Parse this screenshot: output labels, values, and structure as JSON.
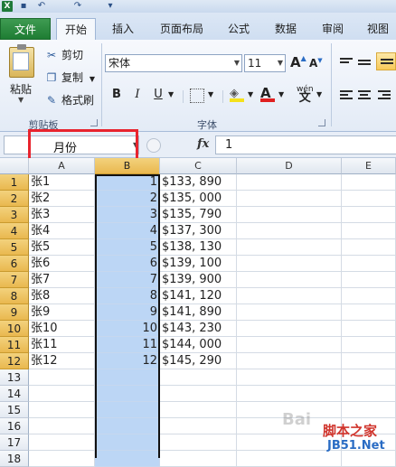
{
  "ribbon": {
    "tabs": [
      "文件",
      "开始",
      "插入",
      "页面布局",
      "公式",
      "数据",
      "审阅",
      "视图"
    ],
    "active_tab": "开始",
    "clipboard": {
      "paste": "粘贴",
      "cut": "剪切",
      "copy": "复制",
      "format_painter": "格式刷",
      "group_label": "剪贴板"
    },
    "font": {
      "name": "宋体",
      "size": "11",
      "bold": "B",
      "italic": "I",
      "underline": "U",
      "group_label": "字体",
      "grow": "A",
      "shrink": "A",
      "font_color": "A",
      "wen": "wén"
    }
  },
  "formula_bar": {
    "name_box": "月份",
    "fx": "fx",
    "formula": "1"
  },
  "grid": {
    "columns": [
      "A",
      "B",
      "C",
      "D",
      "E"
    ],
    "selected_column": "B",
    "rows": [
      {
        "n": "1",
        "a": "张1",
        "b": "1",
        "c": "$133, 890"
      },
      {
        "n": "2",
        "a": "张2",
        "b": "2",
        "c": "$135, 000"
      },
      {
        "n": "3",
        "a": "张3",
        "b": "3",
        "c": "$135, 790"
      },
      {
        "n": "4",
        "a": "张4",
        "b": "4",
        "c": "$137, 300"
      },
      {
        "n": "5",
        "a": "张5",
        "b": "5",
        "c": "$138, 130"
      },
      {
        "n": "6",
        "a": "张6",
        "b": "6",
        "c": "$139, 100"
      },
      {
        "n": "7",
        "a": "张7",
        "b": "7",
        "c": "$139, 900"
      },
      {
        "n": "8",
        "a": "张8",
        "b": "8",
        "c": "$141, 120"
      },
      {
        "n": "9",
        "a": "张9",
        "b": "9",
        "c": "$141, 890"
      },
      {
        "n": "10",
        "a": "张10",
        "b": "10",
        "c": "$143, 230"
      },
      {
        "n": "11",
        "a": "张11",
        "b": "11",
        "c": "$144, 000"
      },
      {
        "n": "12",
        "a": "张12",
        "b": "12",
        "c": "$145, 290"
      },
      {
        "n": "13",
        "a": "",
        "b": "",
        "c": ""
      },
      {
        "n": "14",
        "a": "",
        "b": "",
        "c": ""
      },
      {
        "n": "15",
        "a": "",
        "b": "",
        "c": ""
      },
      {
        "n": "16",
        "a": "",
        "b": "",
        "c": ""
      },
      {
        "n": "17",
        "a": "",
        "b": "",
        "c": ""
      },
      {
        "n": "18",
        "a": "",
        "b": "",
        "c": ""
      }
    ]
  },
  "watermark": {
    "line1": "脚本之家",
    "line2": "JB51.Net",
    "baidu": "Bai"
  },
  "colors": {
    "selection_fill": "#bcd6f5",
    "header_highlight": "#e9b84f",
    "red_highlight": "#e8242e",
    "file_tab": "#1e7d33"
  }
}
